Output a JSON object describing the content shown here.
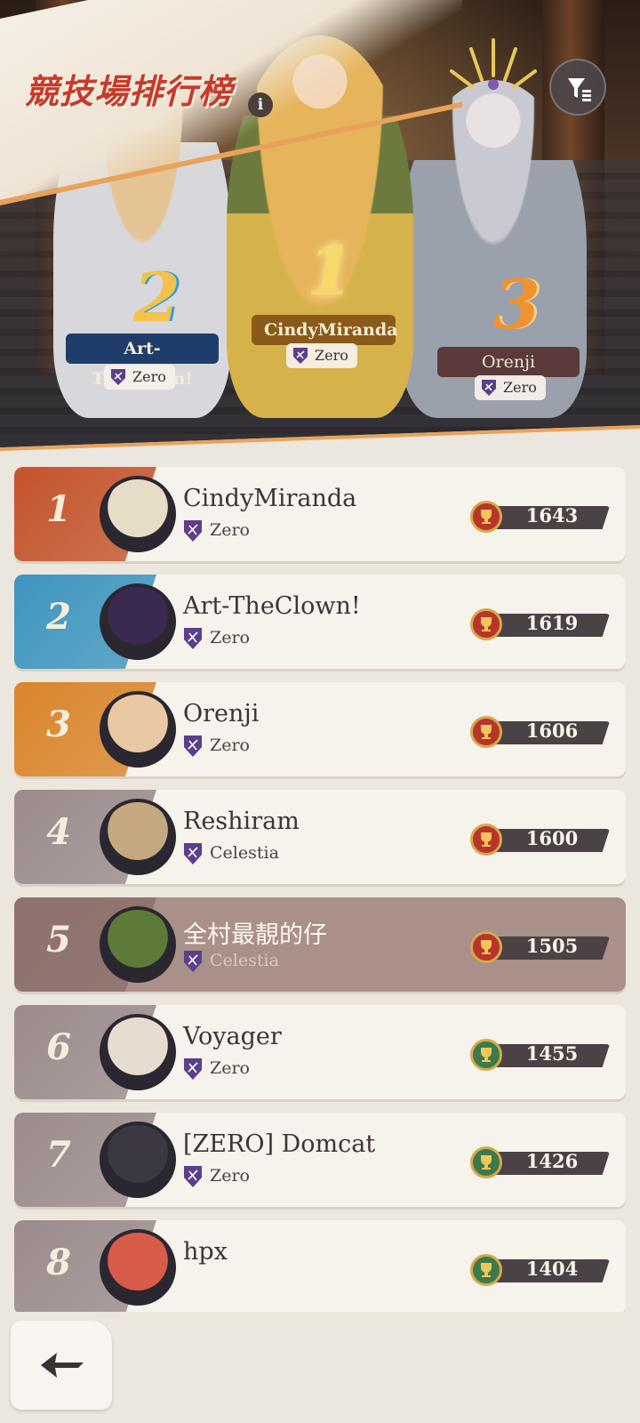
{
  "header": {
    "title": "競技場排行榜",
    "info_icon": "info-icon",
    "filter_icon": "filter-icon"
  },
  "podium": [
    {
      "rank": "2",
      "name": "Art-TheClown!",
      "guild": "Zero",
      "color": "#2f9fd6"
    },
    {
      "rank": "1",
      "name": "CindyMiranda",
      "guild": "Zero",
      "color": "#f4c64a"
    },
    {
      "rank": "3",
      "name": "Orenji",
      "guild": "Zero",
      "color": "#ef8a2a"
    }
  ],
  "rankings": [
    {
      "rank": "1",
      "name": "CindyMiranda",
      "guild": "Zero",
      "score": "1643",
      "tab_color": "#c4542c",
      "avatar_color": "#e7dcc6",
      "trophy": "red"
    },
    {
      "rank": "2",
      "name": "Art-TheClown!",
      "guild": "Zero",
      "score": "1619",
      "tab_color": "#3e95bf",
      "avatar_color": "#3a2a52",
      "trophy": "red"
    },
    {
      "rank": "3",
      "name": "Orenji",
      "guild": "Zero",
      "score": "1606",
      "tab_color": "#d9852a",
      "avatar_color": "#e9c9a4",
      "trophy": "red"
    },
    {
      "rank": "4",
      "name": "Reshiram",
      "guild": "Celestia",
      "score": "1600",
      "tab_color": "#9a8a8c",
      "avatar_color": "#c6a880",
      "trophy": "red"
    },
    {
      "rank": "5",
      "name": "全村最靚的仔",
      "guild": "Celestia",
      "score": "1505",
      "tab_color": "#8e716c",
      "avatar_color": "#5d7a3a",
      "trophy": "red",
      "current_user": true
    },
    {
      "rank": "6",
      "name": "Voyager",
      "guild": "Zero",
      "score": "1455",
      "tab_color": "#9a8a8c",
      "avatar_color": "#e7dcd0",
      "trophy": "green"
    },
    {
      "rank": "7",
      "name": "[ZERO] Domcat",
      "guild": "Zero",
      "score": "1426",
      "tab_color": "#9a8a8c",
      "avatar_color": "#3b3842",
      "trophy": "green"
    },
    {
      "rank": "8",
      "name": "hpx",
      "guild": "",
      "score": "1404",
      "tab_color": "#9a8a8c",
      "avatar_color": "#d85c4a",
      "trophy": "green"
    }
  ],
  "footer": {
    "back_icon": "back-arrow-icon"
  },
  "colors": {
    "title_red": "#c83a2a",
    "trophy_red": "#b7352a",
    "trophy_green": "#3c7a4c",
    "shield_purple": "#5a3f8a"
  }
}
